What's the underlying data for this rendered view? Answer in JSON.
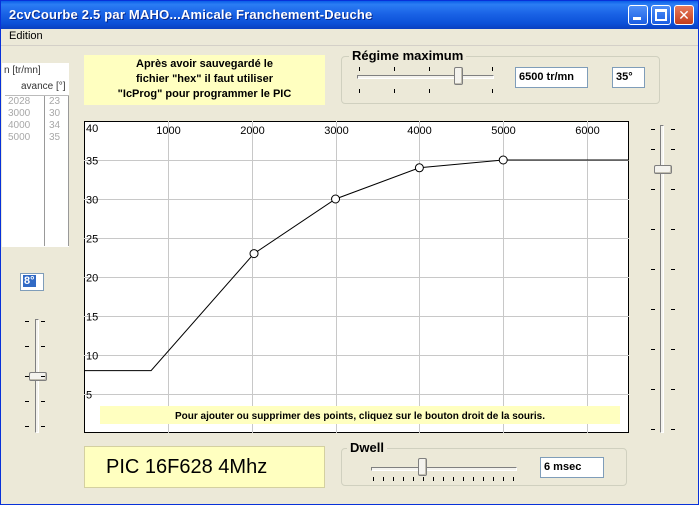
{
  "window": {
    "title": "2cvCourbe 2.5    par MAHO...Amicale Franchement-Deuche",
    "buttons": {
      "minimize": "minimize",
      "maximize": "maximize",
      "close": "✕"
    }
  },
  "menu": {
    "items": [
      "Edition"
    ]
  },
  "left_list": {
    "header_rpm": "n [tr/mn]",
    "header_advance": "avance [°]",
    "rpm_values": [
      "2028",
      "3000",
      "4000",
      "5000"
    ],
    "advance_values": [
      "23",
      "30",
      "34",
      "35"
    ]
  },
  "advance_field": {
    "value": "8°"
  },
  "info_text": {
    "line1": "Après avoir sauvegardé le",
    "line2": "fichier \"hex\" il faut utiliser",
    "line3": "\"IcProg\" pour programmer le PIC"
  },
  "regime": {
    "label": "Régime maximum",
    "rpm_value": "6500 tr/mn",
    "deg_value": "35°",
    "slider_fraction": 0.74
  },
  "dwell": {
    "label": "Dwell",
    "value": "6 msec",
    "slider_fraction": 0.35
  },
  "pic_label": "PIC 16F628 4Mhz",
  "chart_hint": "Pour ajouter ou supprimer des points, cliquez sur le bouton droit de la souris.",
  "colors": {
    "hint_bg": "#ffffc0",
    "titlebar": "#0a5ee8"
  },
  "chart_data": {
    "type": "line",
    "x_ticks": [
      1000,
      2000,
      3000,
      4000,
      5000,
      6000
    ],
    "y_ticks": [
      40,
      35,
      30,
      25,
      20,
      15,
      10,
      5
    ],
    "xlim": [
      0,
      6500
    ],
    "ylim": [
      0,
      40
    ],
    "grid": true,
    "points": [
      {
        "x": 0,
        "y": 8
      },
      {
        "x": 800,
        "y": 8
      },
      {
        "x": 2028,
        "y": 23
      },
      {
        "x": 3000,
        "y": 30
      },
      {
        "x": 4000,
        "y": 34
      },
      {
        "x": 5000,
        "y": 35
      },
      {
        "x": 6500,
        "y": 35
      }
    ],
    "control_points": [
      {
        "x": 2028,
        "y": 23
      },
      {
        "x": 3000,
        "y": 30
      },
      {
        "x": 4000,
        "y": 34
      },
      {
        "x": 5000,
        "y": 35
      }
    ]
  }
}
